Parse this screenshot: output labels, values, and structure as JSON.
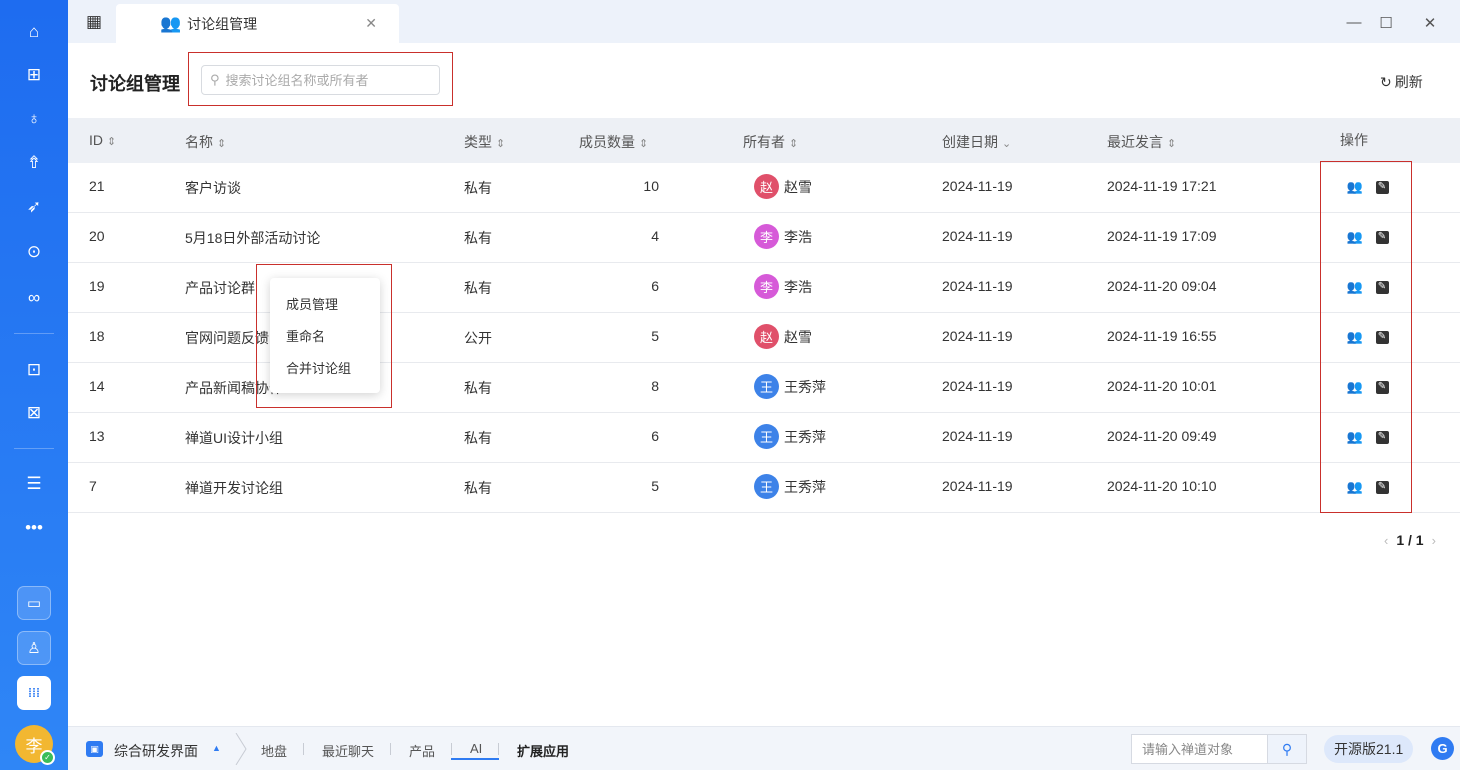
{
  "tab": {
    "label": "讨论组管理",
    "close": "✕"
  },
  "window": {
    "minimize": "—",
    "maximize": "☐",
    "close": "✕"
  },
  "page": {
    "title": "讨论组管理",
    "search_placeholder": "搜索讨论组名称或所有者",
    "refresh_label": "刷新"
  },
  "table": {
    "columns": [
      {
        "label": "ID",
        "sort": "⇕"
      },
      {
        "label": "名称",
        "sort": "⇕"
      },
      {
        "label": "类型",
        "sort": "⇕"
      },
      {
        "label": "成员数量",
        "sort": "⇕"
      },
      {
        "label": "所有者",
        "sort": "⇕"
      },
      {
        "label": "创建日期",
        "sort": "⌄"
      },
      {
        "label": "最近发言",
        "sort": "⇕"
      },
      {
        "label": "操作",
        "sort": ""
      }
    ],
    "rows": [
      {
        "id": "21",
        "name": "客户访谈",
        "type": "私有",
        "members": "10",
        "owner": "赵雪",
        "owner_initial": "赵",
        "owner_color": "#e0506a",
        "created": "2024-11-19",
        "last": "2024-11-19 17:21"
      },
      {
        "id": "20",
        "name": "5月18日外部活动讨论",
        "type": "私有",
        "members": "4",
        "owner": "李浩",
        "owner_initial": "李",
        "owner_color": "#d65ad8",
        "created": "2024-11-19",
        "last": "2024-11-19 17:09"
      },
      {
        "id": "19",
        "name": "产品讨论群",
        "type": "私有",
        "members": "6",
        "owner": "李浩",
        "owner_initial": "李",
        "owner_color": "#d65ad8",
        "created": "2024-11-19",
        "last": "2024-11-20 09:04"
      },
      {
        "id": "18",
        "name": "官网问题反馈",
        "type": "公开",
        "members": "5",
        "owner": "赵雪",
        "owner_initial": "赵",
        "owner_color": "#e0506a",
        "created": "2024-11-19",
        "last": "2024-11-19 16:55"
      },
      {
        "id": "14",
        "name": "产品新闻稿协作",
        "type": "私有",
        "members": "8",
        "owner": "王秀萍",
        "owner_initial": "王",
        "owner_color": "#3d82e8",
        "created": "2024-11-19",
        "last": "2024-11-20 10:01"
      },
      {
        "id": "13",
        "name": "禅道UI设计小组",
        "type": "私有",
        "members": "6",
        "owner": "王秀萍",
        "owner_initial": "王",
        "owner_color": "#3d82e8",
        "created": "2024-11-19",
        "last": "2024-11-20 09:49"
      },
      {
        "id": "7",
        "name": "禅道开发讨论组",
        "type": "私有",
        "members": "5",
        "owner": "王秀萍",
        "owner_initial": "王",
        "owner_color": "#3d82e8",
        "created": "2024-11-19",
        "last": "2024-11-20 10:10"
      }
    ]
  },
  "menu": {
    "items": [
      "成员管理",
      "重命名",
      "合并讨论组"
    ]
  },
  "pager": {
    "text": "1 / 1",
    "prev": "‹",
    "next": "›"
  },
  "bottombar": {
    "workspace": "综合研发界面",
    "nav": [
      "地盘",
      "最近聊天",
      "产品",
      "AI",
      "扩展应用"
    ],
    "object_search_placeholder": "请输入禅道对象",
    "version": "开源版21.1"
  },
  "user": {
    "avatar_initial": "李"
  },
  "colors": {
    "accent": "#2f7bf2",
    "highlight": "#c9302c"
  }
}
